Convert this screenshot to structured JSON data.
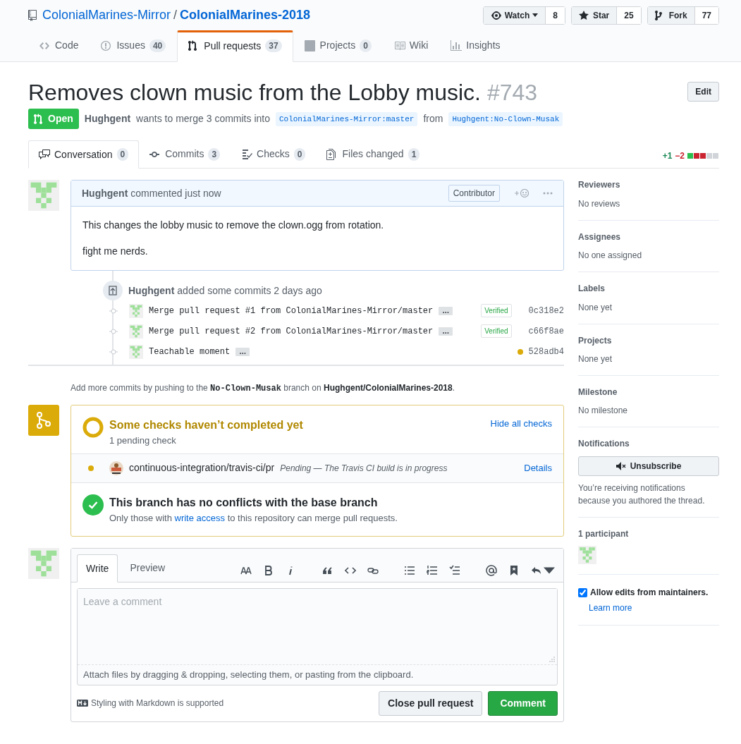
{
  "repo": {
    "owner": "ColonialMarines-Mirror",
    "separator": "/",
    "name": "ColonialMarines-2018"
  },
  "repo_actions": [
    {
      "kind": "watch",
      "label": "Watch",
      "count": "8"
    },
    {
      "kind": "star",
      "label": "Star",
      "count": "25"
    },
    {
      "kind": "fork",
      "label": "Fork",
      "count": "77"
    }
  ],
  "repo_tabs": [
    {
      "kind": "code",
      "label": "Code",
      "selected": false
    },
    {
      "kind": "issues",
      "label": "Issues",
      "count": "40",
      "selected": false
    },
    {
      "kind": "pulls",
      "label": "Pull requests",
      "count": "37",
      "selected": true
    },
    {
      "kind": "projects",
      "label": "Projects",
      "count": "0",
      "selected": false
    },
    {
      "kind": "wiki",
      "label": "Wiki",
      "selected": false
    },
    {
      "kind": "insights",
      "label": "Insights",
      "selected": false
    }
  ],
  "pr": {
    "title": "Removes clown music from the Lobby music.",
    "number": "#743",
    "edit_button": "Edit",
    "state": "Open",
    "author": "Hughgent",
    "merge_text": "wants to merge 3 commits into",
    "base": "ColonialMarines-Mirror:master",
    "from_text": "from",
    "head": "Hughgent:No-Clown-Musak"
  },
  "pr_tabs": [
    {
      "kind": "conversation",
      "label": "Conversation",
      "count": "0",
      "selected": true
    },
    {
      "kind": "commits",
      "label": "Commits",
      "count": "3",
      "selected": false
    },
    {
      "kind": "checks",
      "label": "Checks",
      "count": "0",
      "selected": false
    },
    {
      "kind": "files",
      "label": "Files changed",
      "count": "1",
      "selected": false
    }
  ],
  "diffstat": {
    "additions": "+1",
    "deletions": "−2",
    "blocks": [
      {
        "color": "#2cbe4e"
      },
      {
        "color": "#cb2431"
      },
      {
        "color": "#cb2431"
      },
      {
        "color": "#d1d5da"
      },
      {
        "color": "#d1d5da"
      }
    ]
  },
  "comment": {
    "author": "Hughgent",
    "action": "commented just now",
    "badge": "Contributor",
    "body": [
      "This changes the lobby music to remove the clown.ogg from rotation.",
      "fight me nerds."
    ]
  },
  "commit_event": {
    "author": "Hughgent",
    "action": "added some commits 2 days ago",
    "commits": [
      {
        "message": "Merge pull request #1 from ColonialMarines-Mirror/master",
        "expand": "…",
        "kind": "verified",
        "badge": "Verified",
        "sha": "0c318e2"
      },
      {
        "message": "Merge pull request #2 from ColonialMarines-Mirror/master",
        "expand": "…",
        "kind": "verified",
        "badge": "Verified",
        "sha": "c66f8ae"
      },
      {
        "message": "Teachable moment",
        "expand": "…",
        "kind": "pending",
        "sha": "528adb4"
      }
    ]
  },
  "push_hint": [
    {
      "kind": "plain",
      "text": "Add more commits by pushing to the "
    },
    {
      "kind": "code",
      "text": "No-Clown-Musak"
    },
    {
      "kind": "plain",
      "text": " branch on "
    },
    {
      "kind": "bold",
      "text": "Hughgent/ColonialMarines-2018"
    },
    {
      "kind": "plain",
      "text": "."
    }
  ],
  "checks": {
    "title": "Some checks haven’t completed yet",
    "subtitle": "1 pending check",
    "toggle_link": "Hide all checks",
    "items": [
      {
        "color": "#dbab09",
        "name": "continuous-integration/travis-ci/pr",
        "description": "Pending — The Travis CI build is in progress",
        "link": "Details"
      }
    ]
  },
  "merge_status": {
    "title": "This branch has no conflicts with the base branch",
    "text_before": "Only those with",
    "link": "write access",
    "text_after": "to this repository can merge pull requests."
  },
  "composer": {
    "tabs": [
      {
        "label": "Write",
        "selected": true
      },
      {
        "label": "Preview",
        "selected": false
      }
    ],
    "placeholder": "Leave a comment",
    "attach_hint": "Attach files by dragging & dropping, selecting them, or pasting from the clipboard.",
    "markdown_note": "Styling with Markdown is supported",
    "buttons": [
      {
        "kind": "secondary",
        "label": "Close pull request"
      },
      {
        "kind": "primary",
        "label": "Comment"
      }
    ]
  },
  "sidebar": {
    "sections": [
      {
        "heading": "Reviewers",
        "value": "No reviews"
      },
      {
        "heading": "Assignees",
        "value": "No one assigned"
      },
      {
        "heading": "Labels",
        "value": "None yet"
      },
      {
        "heading": "Projects",
        "value": "None yet"
      },
      {
        "heading": "Milestone",
        "value": "No milestone"
      }
    ],
    "notifications": {
      "heading": "Notifications",
      "button": "Unsubscribe",
      "note": "You’re receiving notifications because you authored the thread."
    },
    "participants": {
      "heading": "1 participant"
    },
    "maintainer_edits": {
      "label": "Allow edits from maintainers.",
      "checked": true,
      "link": "Learn more"
    }
  }
}
